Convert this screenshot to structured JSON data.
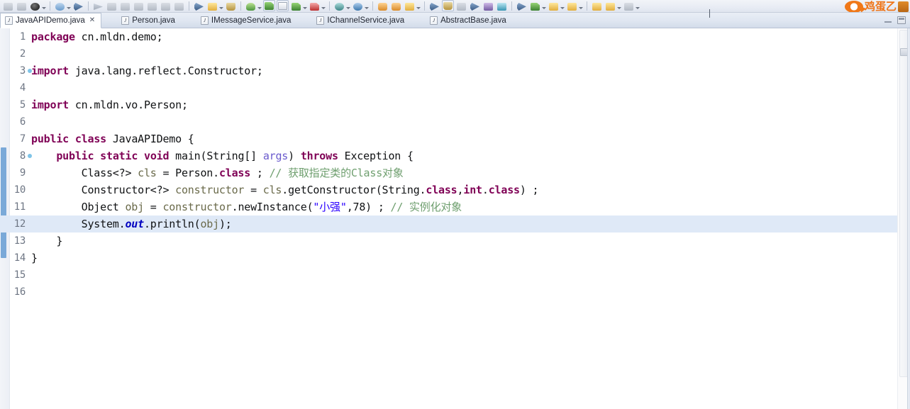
{
  "window": {
    "app": "Eclipse IDE",
    "watermark_text": "鸡蛋乙"
  },
  "toolbar": {
    "icons": [
      "save-icon",
      "save-all-icon",
      "print-icon",
      "build-icon",
      "search-icon",
      "next-annotation-icon",
      "prev-annotation-icon",
      "last-edit-icon",
      "back-icon",
      "forward-icon",
      "link-icon",
      "external-tools-icon",
      "jar-export-icon",
      "debug-icon",
      "run-icon",
      "run-config-icon",
      "coverage-icon",
      "profile-icon",
      "new-java-project-icon",
      "new-class-icon",
      "open-type-icon",
      "open-task-icon",
      "perspective-icon",
      "search-type-icon",
      "javadoc-icon",
      "refresh-icon",
      "console-icon",
      "terminate-icon",
      "help-icon"
    ]
  },
  "tabs": [
    {
      "label": "JavaAPIDemo.java",
      "icon": "java-file-icon",
      "active": true,
      "close_glyph": "✕"
    },
    {
      "label": "Person.java",
      "icon": "java-file-icon",
      "active": false,
      "close_glyph": ""
    },
    {
      "label": "IMessageService.java",
      "icon": "java-file-icon",
      "active": false,
      "close_glyph": ""
    },
    {
      "label": "IChannelService.java",
      "icon": "java-file-icon",
      "active": false,
      "close_glyph": ""
    },
    {
      "label": "AbstractBase.java",
      "icon": "java-file-icon",
      "active": false,
      "close_glyph": ""
    }
  ],
  "tabbar_controls": {
    "minimize": "minimize-icon",
    "maximize": "maximize-icon"
  },
  "editor": {
    "current_line": 12,
    "total_lines_shown": 16,
    "colors": {
      "keyword": "#7f0055",
      "string": "#2a00ff",
      "comment": "#6f9f6f",
      "static_field": "#0000c0",
      "local_var": "#6a6a4a",
      "parameter": "#6a5acd",
      "current_line_bg": "#dfe9f7",
      "gutter_text": "#6e7684",
      "annotation_bar": "#7aa9d8"
    },
    "lines": [
      {
        "n": "1",
        "fold": false,
        "indent": 0,
        "tokens": [
          {
            "t": "package",
            "c": "kw"
          },
          {
            "t": " cn.mldn.demo;",
            "c": ""
          }
        ]
      },
      {
        "n": "2",
        "fold": false,
        "indent": 0,
        "tokens": []
      },
      {
        "n": "3",
        "fold": true,
        "indent": 0,
        "tokens": [
          {
            "t": "import",
            "c": "kw"
          },
          {
            "t": " java.lang.reflect.Constructor;",
            "c": ""
          }
        ]
      },
      {
        "n": "4",
        "fold": false,
        "indent": 0,
        "tokens": []
      },
      {
        "n": "5",
        "fold": false,
        "indent": 0,
        "tokens": [
          {
            "t": "import",
            "c": "kw"
          },
          {
            "t": " cn.mldn.vo.Person;",
            "c": ""
          }
        ]
      },
      {
        "n": "6",
        "fold": false,
        "indent": 0,
        "tokens": []
      },
      {
        "n": "7",
        "fold": false,
        "indent": 0,
        "tokens": [
          {
            "t": "public",
            "c": "kw"
          },
          {
            "t": " ",
            "c": ""
          },
          {
            "t": "class",
            "c": "kw"
          },
          {
            "t": " JavaAPIDemo {",
            "c": ""
          }
        ]
      },
      {
        "n": "8",
        "fold": true,
        "indent": 0,
        "tokens": [
          {
            "t": "    ",
            "c": ""
          },
          {
            "t": "public",
            "c": "kw"
          },
          {
            "t": " ",
            "c": ""
          },
          {
            "t": "static",
            "c": "kw"
          },
          {
            "t": " ",
            "c": ""
          },
          {
            "t": "void",
            "c": "kw"
          },
          {
            "t": " main(String[] ",
            "c": ""
          },
          {
            "t": "args",
            "c": "par"
          },
          {
            "t": ") ",
            "c": ""
          },
          {
            "t": "throws",
            "c": "kw"
          },
          {
            "t": " Exception {",
            "c": ""
          }
        ]
      },
      {
        "n": "9",
        "fold": false,
        "indent": 0,
        "tokens": [
          {
            "t": "        Class<?> ",
            "c": ""
          },
          {
            "t": "cls",
            "c": "loc"
          },
          {
            "t": " = Person.",
            "c": ""
          },
          {
            "t": "class",
            "c": "kw"
          },
          {
            "t": " ; ",
            "c": ""
          },
          {
            "t": "// 获取指定类的Class对象",
            "c": "cmt"
          }
        ]
      },
      {
        "n": "10",
        "fold": false,
        "indent": 0,
        "tokens": [
          {
            "t": "        Constructor<?> ",
            "c": ""
          },
          {
            "t": "constructor",
            "c": "loc"
          },
          {
            "t": " = ",
            "c": ""
          },
          {
            "t": "cls",
            "c": "loc"
          },
          {
            "t": ".getConstructor(String.",
            "c": ""
          },
          {
            "t": "class",
            "c": "kw"
          },
          {
            "t": ",",
            "c": ""
          },
          {
            "t": "int",
            "c": "kw"
          },
          {
            "t": ".",
            "c": ""
          },
          {
            "t": "class",
            "c": "kw"
          },
          {
            "t": ") ;",
            "c": ""
          }
        ]
      },
      {
        "n": "11",
        "fold": false,
        "indent": 0,
        "tokens": [
          {
            "t": "        Object ",
            "c": ""
          },
          {
            "t": "obj",
            "c": "loc"
          },
          {
            "t": " = ",
            "c": ""
          },
          {
            "t": "constructor",
            "c": "loc"
          },
          {
            "t": ".newInstance(",
            "c": ""
          },
          {
            "t": "\"小强\"",
            "c": "str"
          },
          {
            "t": ",78) ; ",
            "c": ""
          },
          {
            "t": "// 实例化对象",
            "c": "cmt"
          }
        ]
      },
      {
        "n": "12",
        "fold": false,
        "indent": 0,
        "tokens": [
          {
            "t": "        System.",
            "c": ""
          },
          {
            "t": "out",
            "c": "sfld"
          },
          {
            "t": ".println(",
            "c": ""
          },
          {
            "t": "obj",
            "c": "loc"
          },
          {
            "t": ");",
            "c": ""
          }
        ]
      },
      {
        "n": "13",
        "fold": false,
        "indent": 0,
        "tokens": [
          {
            "t": "    }",
            "c": ""
          }
        ]
      },
      {
        "n": "14",
        "fold": false,
        "indent": 0,
        "tokens": [
          {
            "t": "}",
            "c": ""
          }
        ]
      },
      {
        "n": "15",
        "fold": false,
        "indent": 0,
        "tokens": []
      },
      {
        "n": "16",
        "fold": false,
        "indent": 0,
        "tokens": []
      }
    ]
  }
}
